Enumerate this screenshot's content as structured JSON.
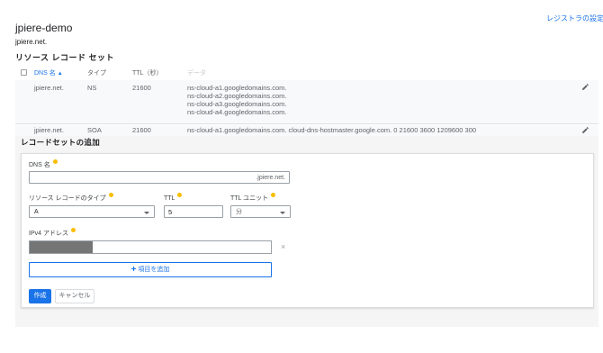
{
  "header": {
    "registrar_link": "レジストラの設定",
    "zone_title": "jpiere-demo",
    "zone_dns": "jpiere.net."
  },
  "records_section": {
    "title": "リソース レコード セット",
    "columns": {
      "name": "DNS 名",
      "type": "タイプ",
      "ttl": "TTL（秒）",
      "data": "データ"
    },
    "rows": [
      {
        "name": "jpiere.net.",
        "type": "NS",
        "ttl": "21600",
        "data": [
          "ns-cloud-a1.googledomains.com.",
          "ns-cloud-a2.googledomains.com.",
          "ns-cloud-a3.googledomains.com.",
          "ns-cloud-a4.googledomains.com."
        ]
      },
      {
        "name": "jpiere.net.",
        "type": "SOA",
        "ttl": "21600",
        "data": [
          "ns-cloud-a1.googledomains.com. cloud-dns-hostmaster.google.com. 0 21600 3600 1209600 300"
        ]
      }
    ]
  },
  "add_form": {
    "title": "レコードセットの追加",
    "dns_name_label": "DNS 名",
    "dns_name_value": "",
    "dns_name_suffix": ".jpiere.net.",
    "record_type_label": "リソース レコードのタイプ",
    "record_type_value": "A",
    "ttl_label": "TTL",
    "ttl_value": "5",
    "ttl_unit_label": "TTL ユニット",
    "ttl_unit_value": "分",
    "ipv4_label": "IPv4 アドレス",
    "remove_symbol": "×",
    "add_item_label": "項目を追加",
    "create_label": "作成",
    "cancel_label": "キャンセル"
  },
  "icons": {
    "edit": "edit-icon",
    "help": "help-icon",
    "sort": "arrow-up-icon",
    "plus": "plus-icon",
    "remove": "close-icon"
  },
  "colors": {
    "accent": "#1a73e8",
    "help": "#fbbc04",
    "row_bg": "#f8f9fa",
    "panel_bg": "#f5f5f5"
  }
}
